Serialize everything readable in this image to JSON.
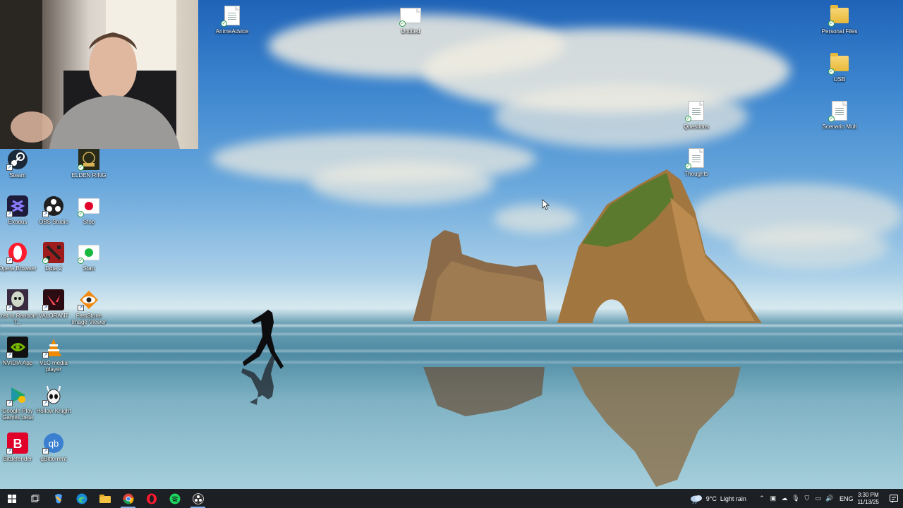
{
  "desktop": {
    "icons": [
      {
        "label": "AnimeAdvice",
        "icon": "text-file-icon"
      },
      {
        "label": "Untitled",
        "icon": "image-file-icon"
      },
      {
        "label": "Personal Files",
        "icon": "folder-icon"
      },
      {
        "label": "USB",
        "icon": "folder-icon"
      },
      {
        "label": "Questions",
        "icon": "text-file-icon"
      },
      {
        "label": "Scenario Mult",
        "icon": "text-file-icon"
      },
      {
        "label": "Thoughts",
        "icon": "text-file-icon"
      },
      {
        "label": "Steam",
        "icon": "steam-icon"
      },
      {
        "label": "ELDEN RING",
        "icon": "elden-ring-icon"
      },
      {
        "label": "Exodus",
        "icon": "exodus-icon"
      },
      {
        "label": "OBS Studio",
        "icon": "obs-icon"
      },
      {
        "label": "Stop",
        "icon": "stop-icon"
      },
      {
        "label": "Opera Browser",
        "icon": "opera-icon"
      },
      {
        "label": "Dota 2",
        "icon": "dota-icon"
      },
      {
        "label": "Start",
        "icon": "start-icon"
      },
      {
        "label": "Lost in Random T...",
        "icon": "lost-in-random-icon"
      },
      {
        "label": "VALORANT",
        "icon": "valorant-icon"
      },
      {
        "label": "FastStone Image Viewer",
        "icon": "faststone-icon"
      },
      {
        "label": "NVIDIA App",
        "icon": "nvidia-icon"
      },
      {
        "label": "VLC media player",
        "icon": "vlc-icon"
      },
      {
        "label": "Google Play Games beta",
        "icon": "google-play-games-icon"
      },
      {
        "label": "Hollow Knight",
        "icon": "hollow-knight-icon"
      },
      {
        "label": "Bitdefender",
        "icon": "bitdefender-icon"
      },
      {
        "label": "qBittorrent",
        "icon": "qbittorrent-icon"
      }
    ]
  },
  "taskbar": {
    "pinned": [
      {
        "name": "start-button",
        "icon": "windows-icon"
      },
      {
        "name": "task-view-button",
        "icon": "task-view-icon"
      },
      {
        "name": "copilot-button",
        "icon": "copilot-icon"
      },
      {
        "name": "edge-button",
        "icon": "edge-icon"
      },
      {
        "name": "file-explorer-button",
        "icon": "folder-icon"
      },
      {
        "name": "chrome-button",
        "icon": "chrome-icon"
      },
      {
        "name": "opera-button",
        "icon": "opera-icon"
      },
      {
        "name": "spotify-button",
        "icon": "spotify-icon"
      },
      {
        "name": "obs-button",
        "icon": "obs-icon"
      }
    ],
    "weather": {
      "temp": "9°C",
      "condition": "Light rain"
    },
    "language": "ENG",
    "clock": {
      "time": "3:30 PM",
      "date": "11/13/25"
    }
  },
  "colors": {
    "taskbar_bg": "#1c1f24",
    "accent": "#7fb0e6"
  }
}
